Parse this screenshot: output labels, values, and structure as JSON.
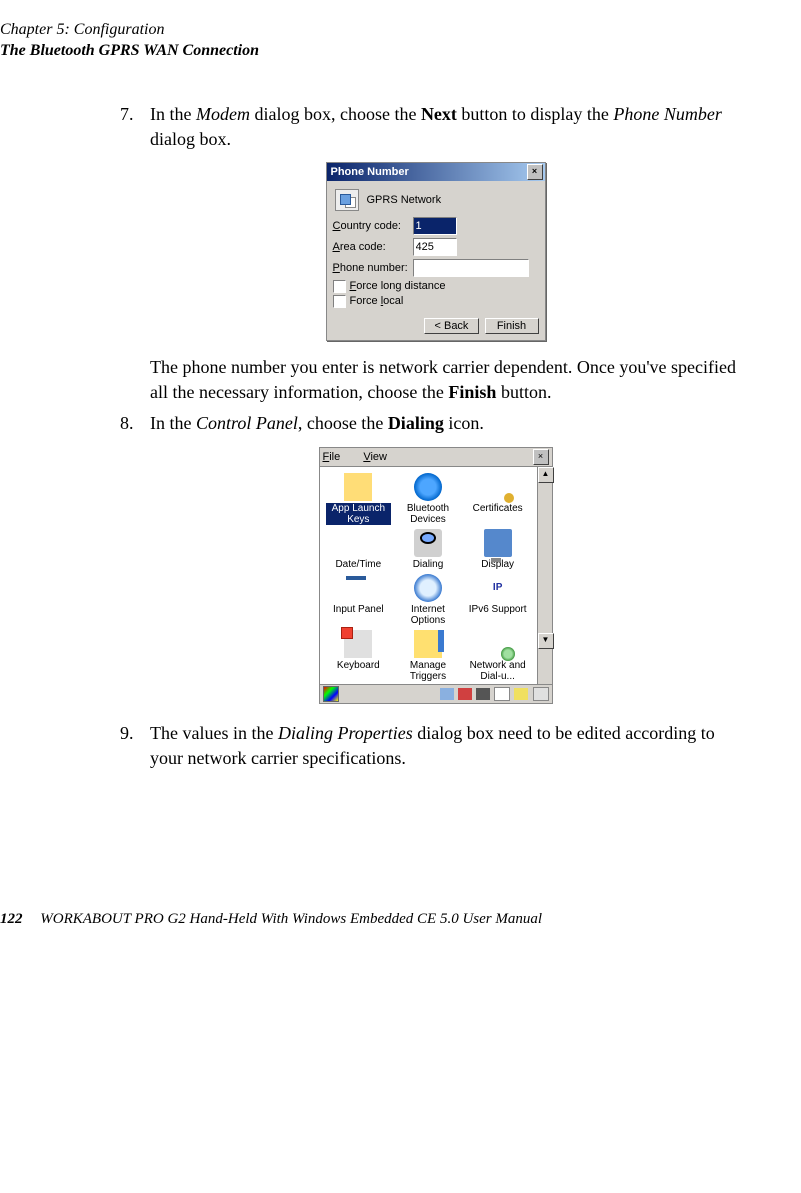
{
  "header": {
    "chapter": "Chapter 5: Configuration",
    "section": "The Bluetooth GPRS WAN Connection"
  },
  "step7": {
    "num": "7.",
    "t1": "In the ",
    "modem": "Modem",
    "t2": " dialog box, choose the ",
    "next": "Next ",
    "t3": "button to display the ",
    "phone": "Phone Number",
    "t4": " dialog box."
  },
  "dlg1": {
    "title": "Phone Number",
    "network": "GPRS Network",
    "country_label": "Country code:",
    "country_value": "1",
    "area_label": "Area code:",
    "area_value": "425",
    "phone_label": "Phone number:",
    "phone_value": "",
    "force_long_u": "F",
    "force_long": "orce long distance",
    "force_local": "Force ",
    "force_local_u": "l",
    "force_local2": "ocal",
    "back": "< Back",
    "finish": "Finish"
  },
  "after7a": "The phone number you enter is network carrier dependent. Once you've specified all the necessary information, choose the ",
  "after7bold": "Finish",
  "after7b": " button.",
  "step8": {
    "num": "8.",
    "t1": "In the ",
    "cp": "Control Panel",
    "t2": ", choose the ",
    "dialing": "Dialing",
    "t3": " icon."
  },
  "cp": {
    "file_u": "F",
    "file": "ile",
    "view_u": "V",
    "view": "iew",
    "items": {
      "applaunch": "App Launch Keys",
      "bluetooth": "Bluetooth Devices",
      "certs": "Certificates",
      "datetime": "Date/Time",
      "dialing": "Dialing",
      "display": "Display",
      "input": "Input Panel",
      "internet": "Internet Options",
      "ipv6": "IPv6 Support",
      "keyboard": "Keyboard",
      "manage": "Manage Triggers",
      "network": "Network and Dial-u..."
    }
  },
  "step9": {
    "num": "9.",
    "t1": "The values in the ",
    "dp": "Dialing Properties",
    "t2": " dialog box need to be edited according to your network carrier specifications."
  },
  "footer": {
    "page": "122",
    "manual": "WORKABOUT PRO G2 Hand-Held With Windows Embedded CE 5.0 User Manual"
  }
}
